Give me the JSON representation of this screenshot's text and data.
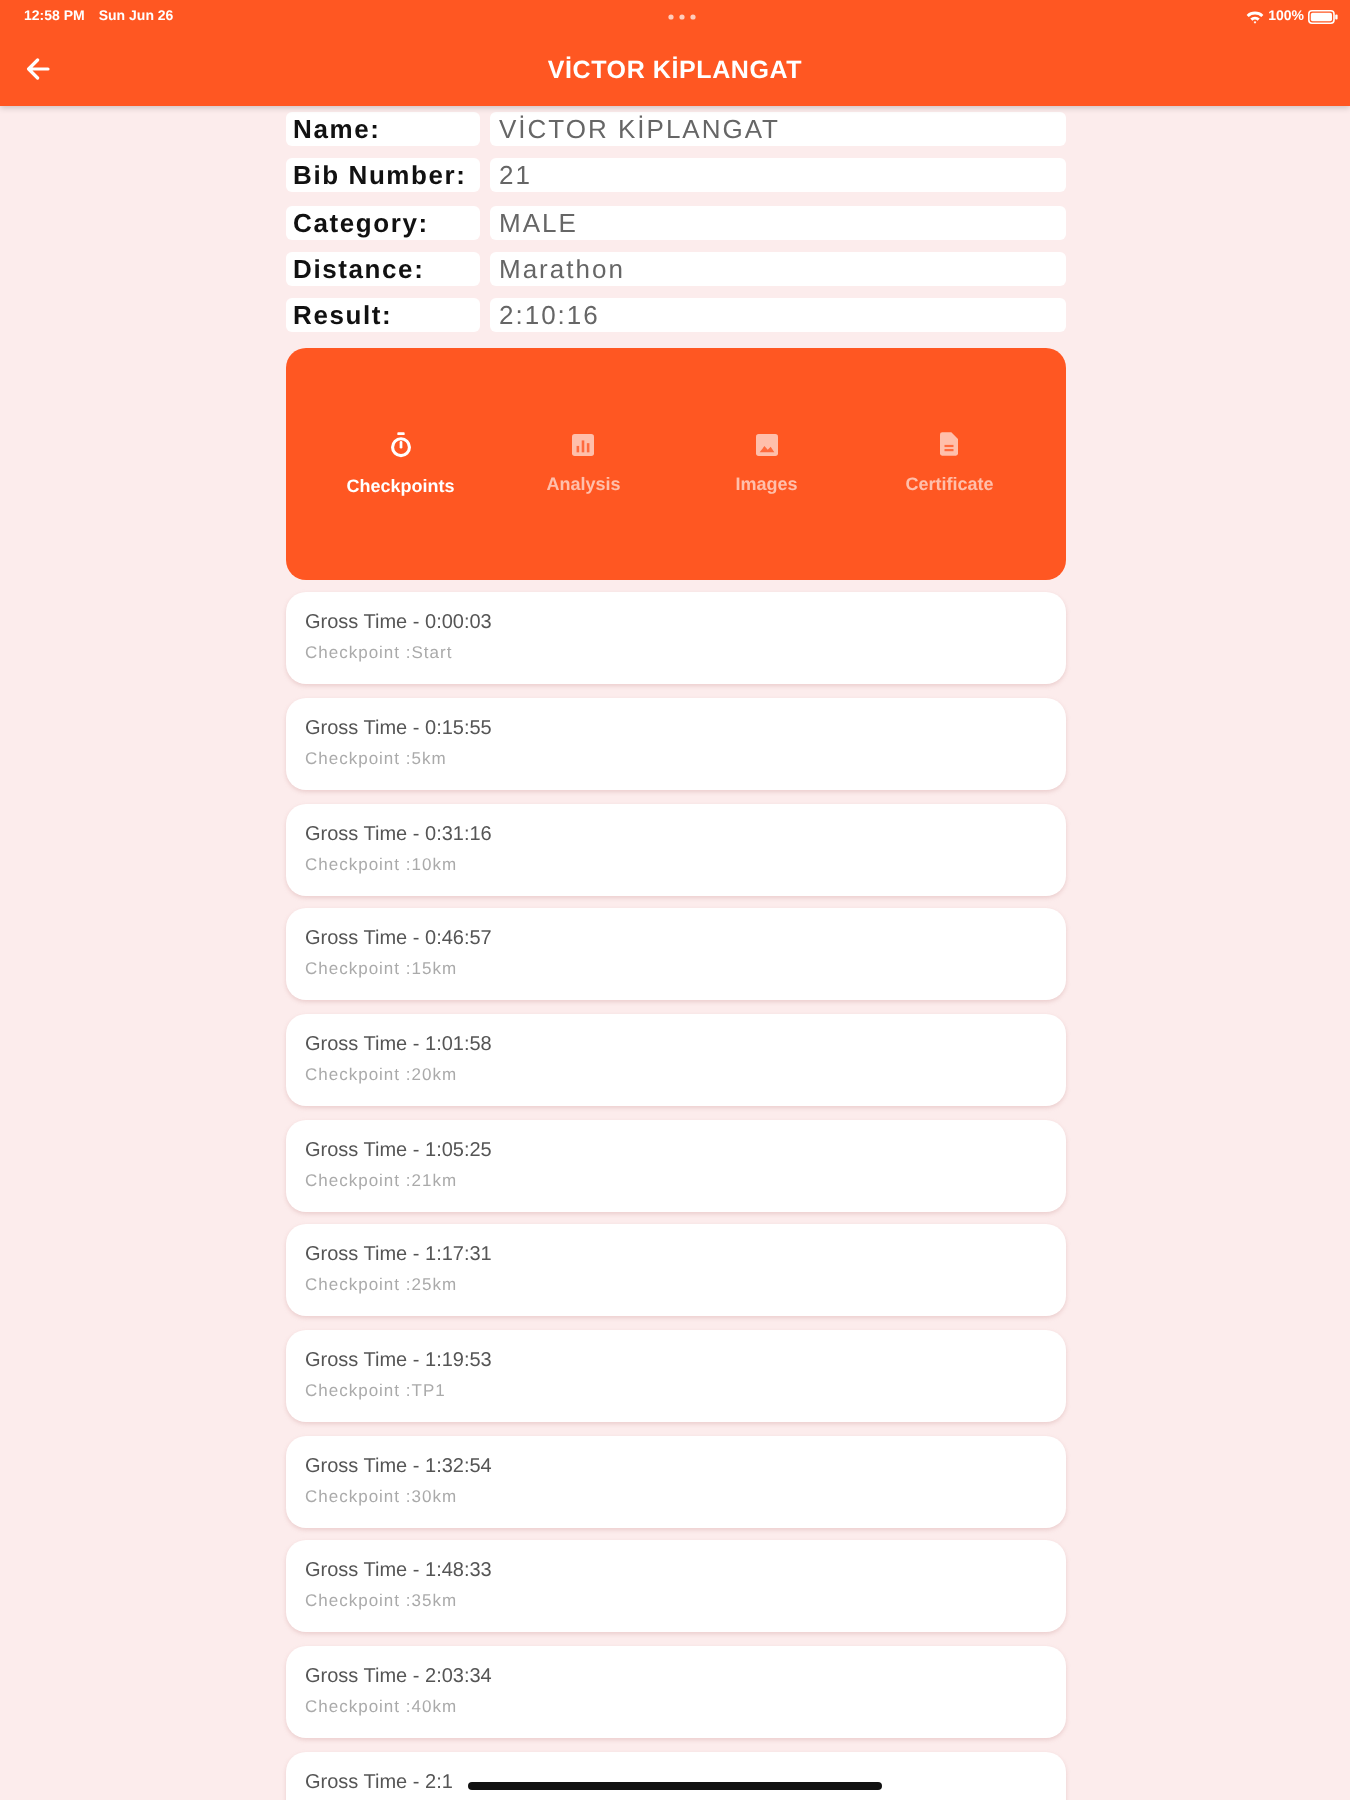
{
  "status_bar": {
    "time": "12:58 PM",
    "date": "Sun Jun 26",
    "battery": "100%"
  },
  "app_bar": {
    "title": "VİCTOR KİPLANGAT"
  },
  "details": [
    {
      "label": "Name:",
      "value": "VİCTOR KİPLANGAT"
    },
    {
      "label": "Bib Number:",
      "value": "21"
    },
    {
      "label": "Category:",
      "value": "MALE"
    },
    {
      "label": "Distance:",
      "value": "Marathon"
    },
    {
      "label": "Result:",
      "value": "2:10:16"
    }
  ],
  "tabs": [
    {
      "label": "Checkpoints",
      "selected": true
    },
    {
      "label": "Analysis",
      "selected": false
    },
    {
      "label": "Images",
      "selected": false
    },
    {
      "label": "Certificate",
      "selected": false
    }
  ],
  "checkpoints": [
    {
      "gross_time": "Gross Time - 0:00:03",
      "checkpoint": "Checkpoint :Start"
    },
    {
      "gross_time": "Gross Time - 0:15:55",
      "checkpoint": "Checkpoint :5km"
    },
    {
      "gross_time": "Gross Time - 0:31:16",
      "checkpoint": "Checkpoint :10km"
    },
    {
      "gross_time": "Gross Time - 0:46:57",
      "checkpoint": "Checkpoint :15km"
    },
    {
      "gross_time": "Gross Time - 1:01:58",
      "checkpoint": "Checkpoint :20km"
    },
    {
      "gross_time": "Gross Time - 1:05:25",
      "checkpoint": "Checkpoint :21km"
    },
    {
      "gross_time": "Gross Time - 1:17:31",
      "checkpoint": "Checkpoint :25km"
    },
    {
      "gross_time": "Gross Time - 1:19:53",
      "checkpoint": "Checkpoint :TP1"
    },
    {
      "gross_time": "Gross Time - 1:32:54",
      "checkpoint": "Checkpoint :30km"
    },
    {
      "gross_time": "Gross Time - 1:48:33",
      "checkpoint": "Checkpoint :35km"
    },
    {
      "gross_time": "Gross Time - 2:03:34",
      "checkpoint": "Checkpoint :40km"
    },
    {
      "gross_time": "Gross Time - 2:1"
    }
  ]
}
